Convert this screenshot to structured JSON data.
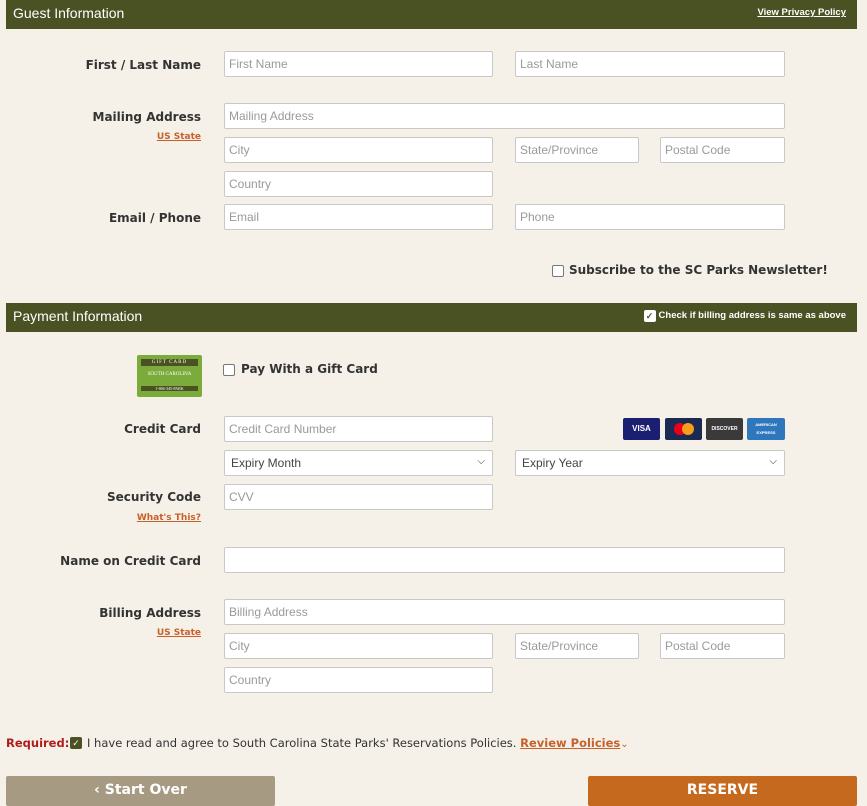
{
  "guest": {
    "title": "Guest Information",
    "privacy_link": "View Privacy Policy",
    "name_label": "First / Last Name",
    "first_name_placeholder": "First Name",
    "last_name_placeholder": "Last Name",
    "mailing_label": "Mailing Address",
    "us_state_link": "US State",
    "address_placeholder": "Mailing Address",
    "city_placeholder": "City",
    "state_placeholder": "State/Province",
    "postal_placeholder": "Postal Code",
    "country_placeholder": "Country",
    "email_phone_label": "Email / Phone",
    "email_placeholder": "Email",
    "phone_placeholder": "Phone",
    "newsletter_label": "Subscribe to the SC Parks Newsletter!"
  },
  "payment": {
    "title": "Payment Information",
    "billing_same_label": "Check if billing address is same as above",
    "gift_card_top": "GIFT CARD",
    "gift_card_mid": "SOUTH CAROLINA",
    "gift_card_bottom": "1-866-345-PARK",
    "gift_card_label": "Pay With a Gift Card",
    "credit_card_label": "Credit Card",
    "card_number_placeholder": "Credit Card Number",
    "cards": {
      "visa": "VISA",
      "mastercard": "MasterCard",
      "discover": "DISCOVER",
      "amex": "AMERICAN EXPRESS"
    },
    "expiry_month": "Expiry Month",
    "expiry_year": "Expiry Year",
    "security_label": "Security Code",
    "whats_this": "What's This?",
    "cvv_placeholder": "CVV",
    "name_on_card_label": "Name on Credit Card",
    "name_on_card_value": "",
    "billing_label": "Billing Address",
    "us_state_link": "US State",
    "billing_placeholder": "Billing Address",
    "city_placeholder": "City",
    "state_placeholder": "State/Province",
    "postal_placeholder": "Postal Code",
    "country_placeholder": "Country"
  },
  "footer": {
    "required_label": "Required:",
    "agree_text": "I have read and agree to South Carolina State Parks' Reservations Policies.",
    "review_link": "Review Policies",
    "start_over": "Start Over",
    "reserve": "RESERVE"
  },
  "colors": {
    "bar": "#4a5123",
    "link": "#c8602a",
    "reserve": "#c5691f",
    "start_over": "#a69a82",
    "required": "#b01c1c"
  }
}
